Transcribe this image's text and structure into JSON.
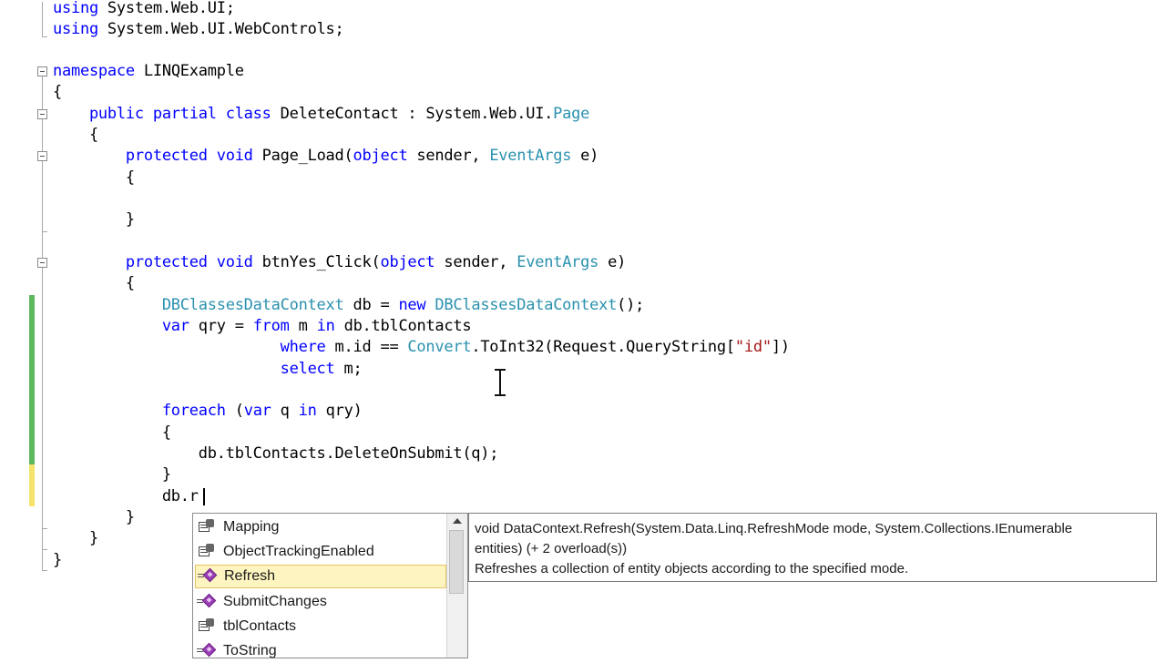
{
  "code": {
    "l1_kw": "using",
    "l1_rest": " System.Web.UI;",
    "l2_kw": "using",
    "l2_rest": " System.Web.UI.WebControls;",
    "l3_kw": "namespace",
    "l3_rest": " LINQExample",
    "l4": "{",
    "l5_kw": "    public partial class",
    "l5_name": " DeleteContact : System.Web.UI.",
    "l5_ty": "Page",
    "l6": "    {",
    "l7_kw1": "        protected void",
    "l7_a": " Page_Load(",
    "l7_kw2": "object",
    "l7_b": " sender, ",
    "l7_ty": "EventArgs",
    "l7_c": " e)",
    "l8": "        {",
    "l9": "        }",
    "l10_kw1": "        protected void",
    "l10_a": " btnYes_Click(",
    "l10_kw2": "object",
    "l10_b": " sender, ",
    "l10_ty": "EventArgs",
    "l10_c": " e)",
    "l11": "        {",
    "l12_ty1": "            DBClassesDataContext",
    "l12_a": " db = ",
    "l12_kw": "new",
    "l12_ty2": " DBClassesDataContext",
    "l12_b": "();",
    "l13_kw1": "            var",
    "l13_a": " qry = ",
    "l13_kw2": "from",
    "l13_b": " m ",
    "l13_kw3": "in",
    "l13_c": " db.tblContacts",
    "l14_kw": "                         where",
    "l14_a": " m.id == ",
    "l14_ty": "Convert",
    "l14_b": ".ToInt32(Request.QueryString[",
    "l14_st": "\"id\"",
    "l14_c": "])",
    "l15_kw": "                         select",
    "l15_a": " m;",
    "l16_kw1": "            foreach",
    "l16_a": " (",
    "l16_kw2": "var",
    "l16_b": " q ",
    "l16_kw3": "in",
    "l16_c": " qry)",
    "l17": "            {",
    "l18": "                db.tblContacts.DeleteOnSubmit(q);",
    "l19": "            }",
    "l20": "            db.r",
    "l21": "        }",
    "l22": "    }",
    "l23": "}"
  },
  "completion": {
    "items": [
      {
        "label": "Mapping",
        "icon": "property-icon"
      },
      {
        "label": "ObjectTrackingEnabled",
        "icon": "property-icon"
      },
      {
        "label": "Refresh",
        "icon": "method-icon"
      },
      {
        "label": "SubmitChanges",
        "icon": "method-icon"
      },
      {
        "label": "tblContacts",
        "icon": "property-icon"
      },
      {
        "label": "ToString",
        "icon": "method-icon"
      }
    ],
    "selected": "Refresh"
  },
  "tooltip": {
    "line1": "void DataContext.Refresh(System.Data.Linq.RefreshMode mode, System.Collections.IEnumerable",
    "line2": "entities)  (+ 2 overload(s))",
    "line3": "Refreshes a collection of entity objects according to the specified mode."
  },
  "colors": {
    "keyword": "#0000ff",
    "type": "#2b91af",
    "string": "#a31515",
    "saved_change": "#5eb85e",
    "unsaved_change": "#f5e46b",
    "selection": "#fdf4bf"
  }
}
